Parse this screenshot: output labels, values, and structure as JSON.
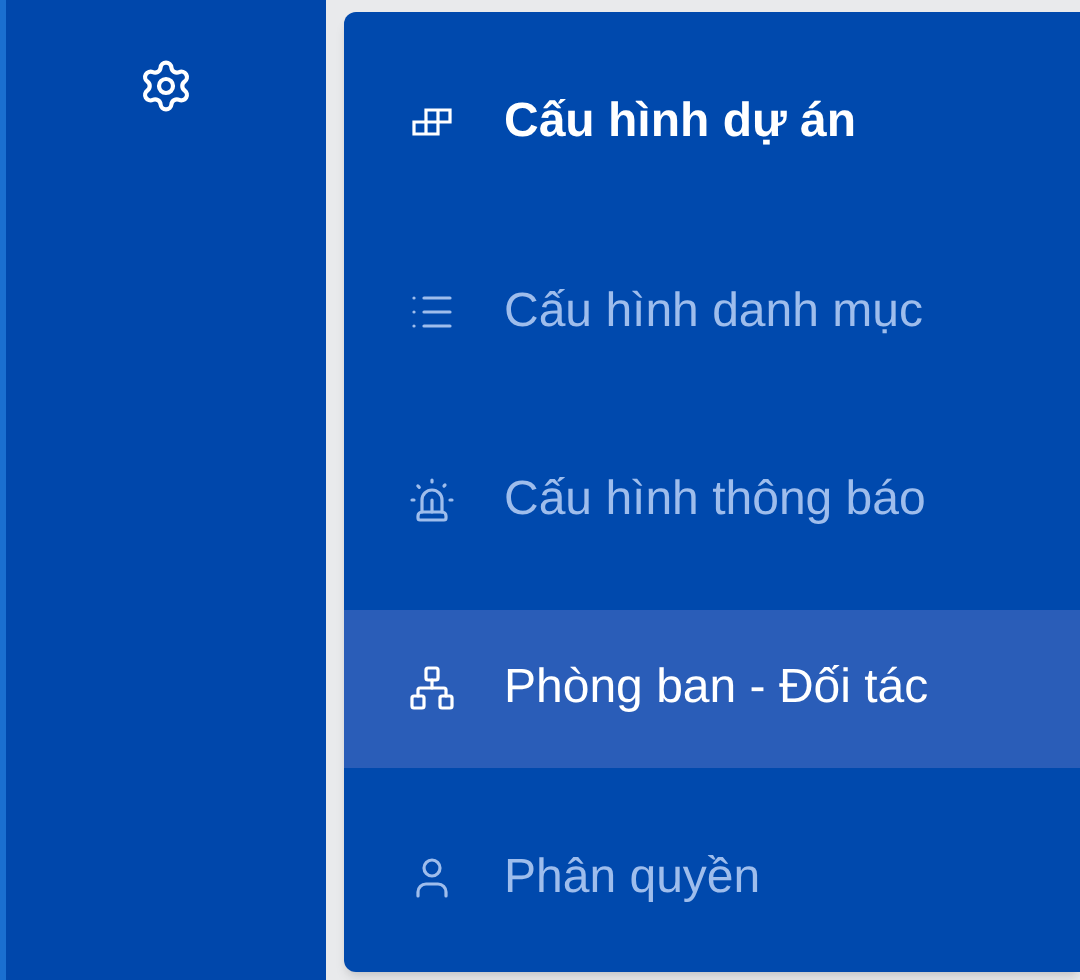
{
  "sidebar": {
    "items": [
      {
        "kind": "settings",
        "selected": false
      }
    ]
  },
  "menu": {
    "items": [
      {
        "kind": "blocks",
        "label": "Cấu hình dự án",
        "selected": true,
        "hovered": false
      },
      {
        "kind": "list",
        "label": "Cấu hình danh mục",
        "selected": false,
        "hovered": false
      },
      {
        "kind": "siren",
        "label": "Cấu hình thông báo",
        "selected": false,
        "hovered": false
      },
      {
        "kind": "network",
        "label": "Phòng ban - Đối tác",
        "selected": false,
        "hovered": true
      },
      {
        "kind": "user",
        "label": "Phân quyền",
        "selected": false,
        "hovered": false
      }
    ]
  }
}
